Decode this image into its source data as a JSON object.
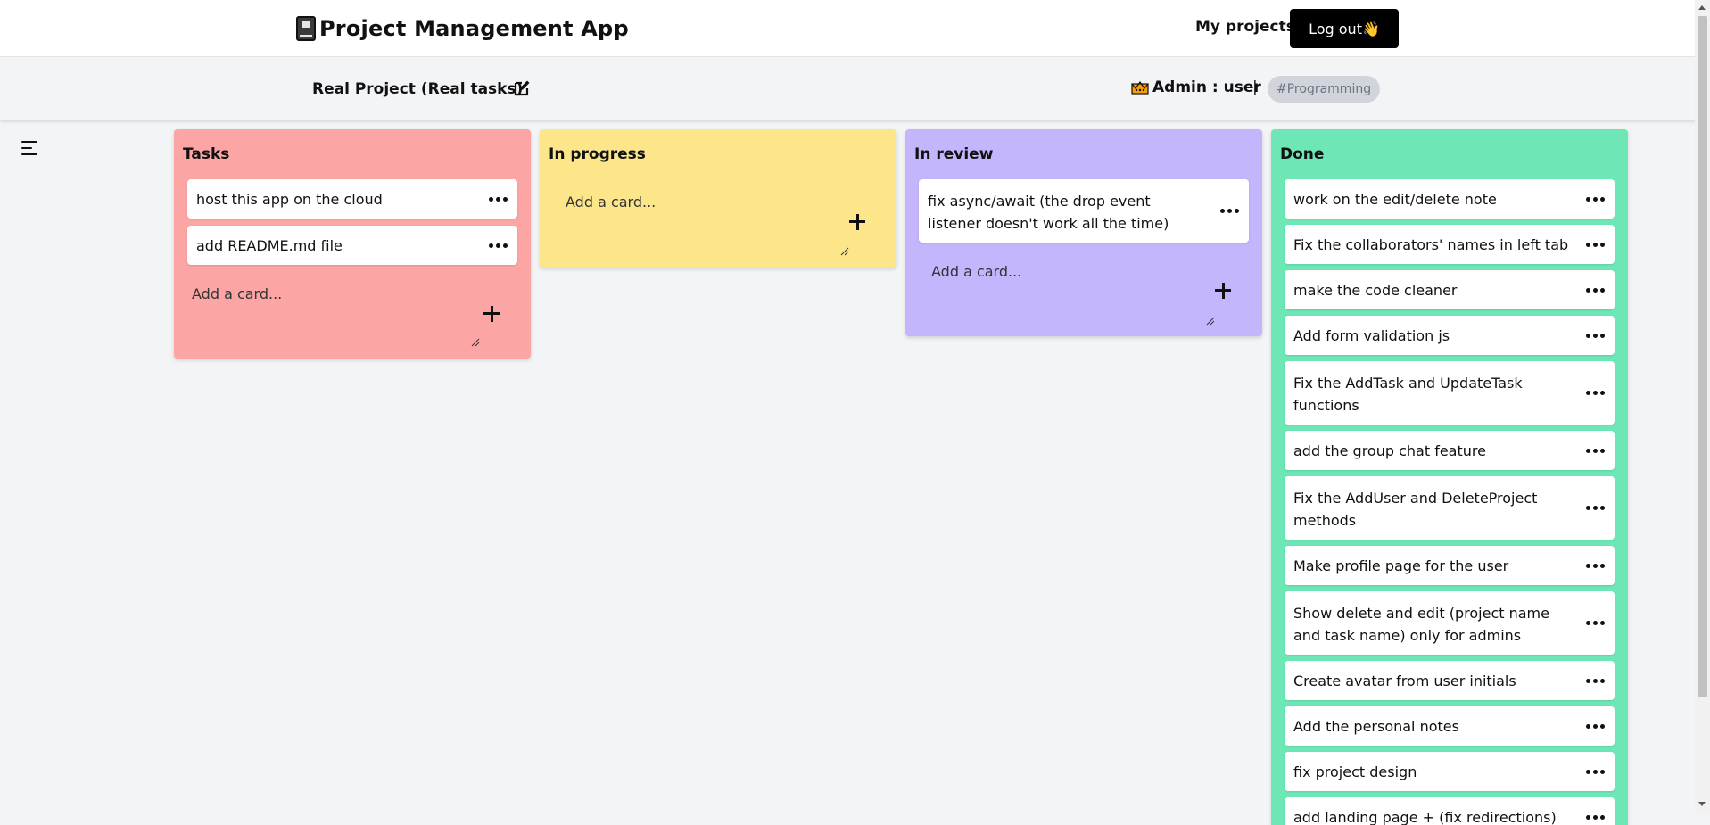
{
  "app": {
    "title": "Project Management App",
    "nav_link": "My projects",
    "logout_label": "Log out👋"
  },
  "project": {
    "title": "Real Project (Real tasks)",
    "admin_label": "Admin : user",
    "separator": "|",
    "tag": "#Programming"
  },
  "colors": {
    "tasks": "#fca5a5",
    "in_progress": "#fde68a",
    "in_review": "#c4b5fd",
    "done": "#6ee7b7"
  },
  "icons": [
    "book-icon",
    "edit-icon",
    "crown-icon",
    "menu-icon",
    "dots-icon",
    "plus-icon"
  ],
  "add_card_placeholder": "Add a card...",
  "columns": [
    {
      "title": "Tasks",
      "cards": [
        "host this app on the cloud",
        "add README.md file"
      ]
    },
    {
      "title": "In progress",
      "cards": []
    },
    {
      "title": "In review",
      "cards": [
        "fix async/await (the drop event listener doesn't work all the time)"
      ]
    },
    {
      "title": "Done",
      "cards": [
        "work on the edit/delete note",
        "Fix the collaborators' names in left tab",
        "make the code cleaner",
        "Add form validation js",
        "Fix the AddTask and UpdateTask functions",
        "add the group chat feature",
        "Fix the AddUser and DeleteProject methods",
        "Make profile page for the user",
        "Show delete and edit (project name and task name) only for admins",
        "Create avatar from user initials",
        "Add the personal notes",
        "fix project design",
        "add landing page + (fix redirections)"
      ]
    }
  ]
}
